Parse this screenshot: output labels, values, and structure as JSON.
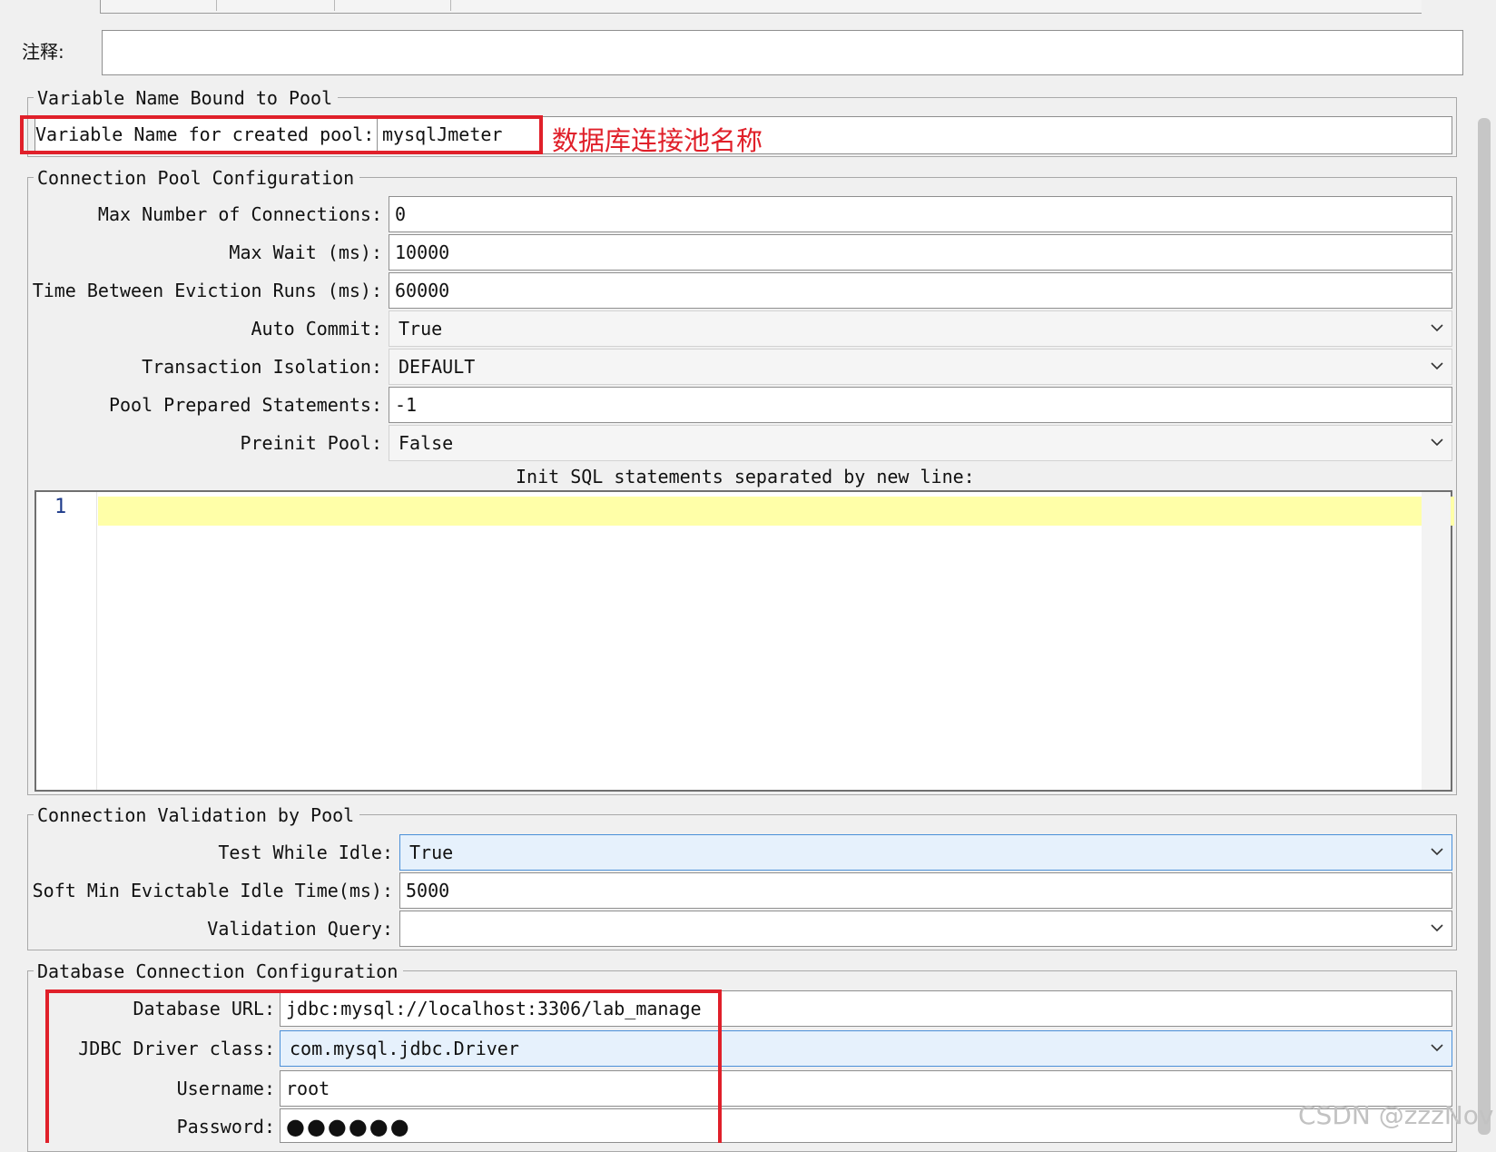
{
  "comment": {
    "label": "注释:",
    "value": ""
  },
  "variable_group": {
    "title": "Variable Name Bound to Pool",
    "label": "Variable Name for created pool:",
    "value": "mysqlJmeter",
    "annotation": "数据库连接池名称"
  },
  "pool_config": {
    "title": "Connection Pool Configuration",
    "max_connections": {
      "label": "Max Number of Connections:",
      "value": "0"
    },
    "max_wait": {
      "label": "Max Wait (ms):",
      "value": "10000"
    },
    "eviction_runs": {
      "label": "Time Between Eviction Runs (ms):",
      "value": "60000"
    },
    "auto_commit": {
      "label": "Auto Commit:",
      "value": "True"
    },
    "transaction_isolation": {
      "label": "Transaction Isolation:",
      "value": "DEFAULT"
    },
    "pool_prepared": {
      "label": "Pool Prepared Statements:",
      "value": "-1"
    },
    "preinit_pool": {
      "label": "Preinit Pool:",
      "value": "False"
    },
    "init_sql_label": "Init SQL statements separated by new line:",
    "line_number": "1"
  },
  "validation": {
    "title": "Connection Validation by Pool",
    "test_while_idle": {
      "label": "Test While Idle:",
      "value": "True"
    },
    "soft_min_idle": {
      "label": "Soft Min Evictable Idle Time(ms):",
      "value": "5000"
    },
    "validation_query": {
      "label": "Validation Query:",
      "value": ""
    }
  },
  "database": {
    "title": "Database Connection Configuration",
    "url": {
      "label": "Database URL:",
      "value": "jdbc:mysql://localhost:3306/lab_manage"
    },
    "driver": {
      "label": "JDBC Driver class:",
      "value": "com.mysql.jdbc.Driver"
    },
    "username": {
      "label": "Username:",
      "value": "root"
    },
    "password": {
      "label": "Password:",
      "value": "●●●●●●"
    }
  },
  "watermark": "CSDN @zzzNov"
}
